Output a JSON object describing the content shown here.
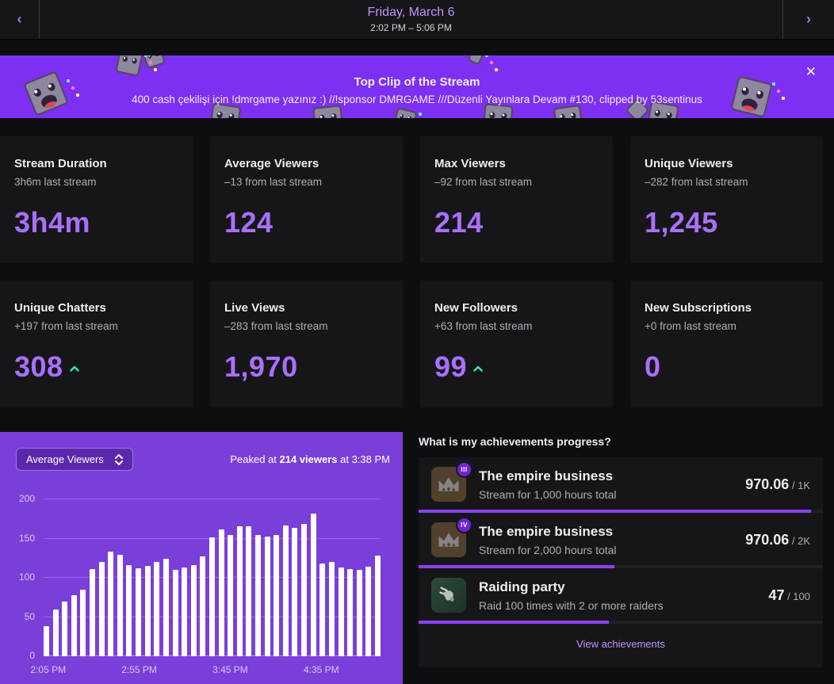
{
  "header": {
    "title": "Friday, March 6",
    "time_range": "2:02 PM – 5:06 PM",
    "prev_icon": "‹",
    "next_icon": "›"
  },
  "banner": {
    "title": "Top Clip of the Stream",
    "subtitle": "400 cash çekilişi için !dmrgame yazınız :) //!sponsor DMRGAME ///Düzenli Yayınlara Devam #130, clipped by 53sentinus",
    "close_icon": "✕"
  },
  "stats": [
    {
      "title": "Stream Duration",
      "subtitle": "3h6m last stream",
      "value": "3h4m"
    },
    {
      "title": "Average Viewers",
      "subtitle": "–13 from last stream",
      "value": "124"
    },
    {
      "title": "Max Viewers",
      "subtitle": "–92 from last stream",
      "value": "214"
    },
    {
      "title": "Unique Viewers",
      "subtitle": "–282 from last stream",
      "value": "1,245"
    },
    {
      "title": "Unique Chatters",
      "subtitle": "+197 from last stream",
      "value": "308",
      "trend": "up"
    },
    {
      "title": "Live Views",
      "subtitle": "–283 from last stream",
      "value": "1,970"
    },
    {
      "title": "New Followers",
      "subtitle": "+63 from last stream",
      "value": "99",
      "trend": "up"
    },
    {
      "title": "New Subscriptions",
      "subtitle": "+0 from last stream",
      "value": "0"
    }
  ],
  "chart_data": {
    "type": "bar",
    "title": "Average Viewers",
    "selector_label": "Average Viewers",
    "peak_prefix": "Peaked at ",
    "peak_bold": "214 viewers",
    "peak_suffix": " at 3:38 PM",
    "ylim": [
      0,
      200
    ],
    "yticks": [
      0,
      50,
      100,
      150,
      200
    ],
    "bar_color": "#ffffff",
    "grid": true,
    "values": [
      38,
      60,
      70,
      78,
      85,
      111,
      120,
      133,
      129,
      116,
      112,
      115,
      120,
      124,
      110,
      113,
      116,
      127,
      152,
      162,
      155,
      166,
      166,
      155,
      153,
      155,
      167,
      164,
      169,
      182,
      118,
      120,
      113,
      111,
      110,
      114,
      128
    ],
    "x_ticks": [
      {
        "index": 0,
        "label": "2:05 PM"
      },
      {
        "index": 10,
        "label": "2:55 PM"
      },
      {
        "index": 20,
        "label": "3:45 PM"
      },
      {
        "index": 30,
        "label": "4:35 PM"
      }
    ]
  },
  "achievements": {
    "heading": "What is my achievements progress?",
    "items": [
      {
        "badge": "III",
        "icon": "crown",
        "title": "The empire business",
        "desc": "Stream for 1,000 hours total",
        "value": "970.06",
        "total": " / 1K",
        "progress": 97
      },
      {
        "badge": "IV",
        "icon": "crown",
        "title": "The empire business",
        "desc": "Stream for 2,000 hours total",
        "value": "970.06",
        "total": " / 2K",
        "progress": 48.5
      },
      {
        "badge": "",
        "icon": "raid",
        "title": "Raiding party",
        "desc": "Raid 100 times with 2 or more raiders",
        "value": "47",
        "total": " / 100",
        "progress": 47
      }
    ],
    "link_label": "View achievements"
  },
  "colors": {
    "accent_value": "#a970ff",
    "banner_purple": "#7d2ff2",
    "chart_panel_purple": "#7a3fd8",
    "positive_trend": "#2de6c0",
    "progress_bar": "#8c40f5",
    "link_purple": "#bf94ff"
  }
}
